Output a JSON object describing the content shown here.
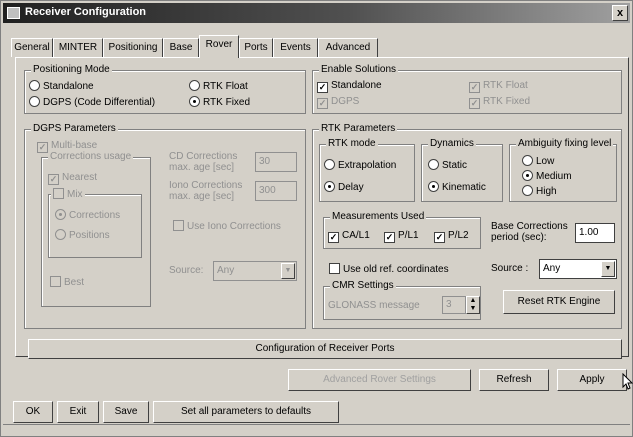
{
  "window": {
    "title": "Receiver Configuration",
    "close": "x"
  },
  "tabs": [
    {
      "label": "General"
    },
    {
      "label": "MINTER"
    },
    {
      "label": "Positioning"
    },
    {
      "label": "Base"
    },
    {
      "label": "Rover",
      "active": true
    },
    {
      "label": "Ports"
    },
    {
      "label": "Events"
    },
    {
      "label": "Advanced"
    }
  ],
  "positioning_mode": {
    "title": "Positioning Mode",
    "standalone": "Standalone",
    "rtk_float": "RTK Float",
    "dgps": "DGPS (Code Differential)",
    "rtk_fixed": "RTK Fixed",
    "selected": "RTK Fixed"
  },
  "enable_solutions": {
    "title": "Enable Solutions",
    "standalone": "Standalone",
    "dgps": "DGPS",
    "rtk_float": "RTK Float",
    "rtk_fixed": "RTK Fixed"
  },
  "dgps": {
    "title": "DGPS Parameters",
    "multibase": "Multi-base",
    "corrections_usage": "Corrections usage",
    "nearest": "Nearest",
    "mix": "Mix",
    "corrections": "Corrections",
    "positions": "Positions",
    "best": "Best",
    "cd_label_1": "CD Corrections",
    "cd_label_2": "max. age [sec]",
    "cd_value": "30",
    "iono_label_1": "Iono Corrections",
    "iono_label_2": "max. age [sec]",
    "iono_value": "300",
    "use_iono": "Use Iono Corrections",
    "source_label": "Source:",
    "source_value": "Any"
  },
  "rtk": {
    "title": "RTK Parameters",
    "mode_title": "RTK mode",
    "extrapolation": "Extrapolation",
    "delay": "Delay",
    "dynamics_title": "Dynamics",
    "static": "Static",
    "kinematic": "Kinematic",
    "ambiguity_title": "Ambiguity fixing level",
    "low": "Low",
    "medium": "Medium",
    "high": "High",
    "measurements_title": "Measurements Used",
    "ca_l1": "CA/L1",
    "p_l1": "P/L1",
    "p_l2": "P/L2",
    "base_corr_1": "Base Corrections",
    "base_corr_2": "period (sec):",
    "base_corr_value": "1.00",
    "use_old_ref": "Use old ref. coordinates",
    "source_label": "Source :",
    "source_value": "Any",
    "cmr_title": "CMR Settings",
    "glonass_label": "GLONASS message",
    "glonass_value": "3",
    "reset": "Reset RTK Engine"
  },
  "buttons": {
    "config_ports": "Configuration of Receiver Ports",
    "advanced_rover": "Advanced Rover Settings",
    "refresh": "Refresh",
    "apply": "Apply",
    "ok": "OK",
    "exit": "Exit",
    "save": "Save",
    "defaults": "Set all parameters to defaults"
  }
}
